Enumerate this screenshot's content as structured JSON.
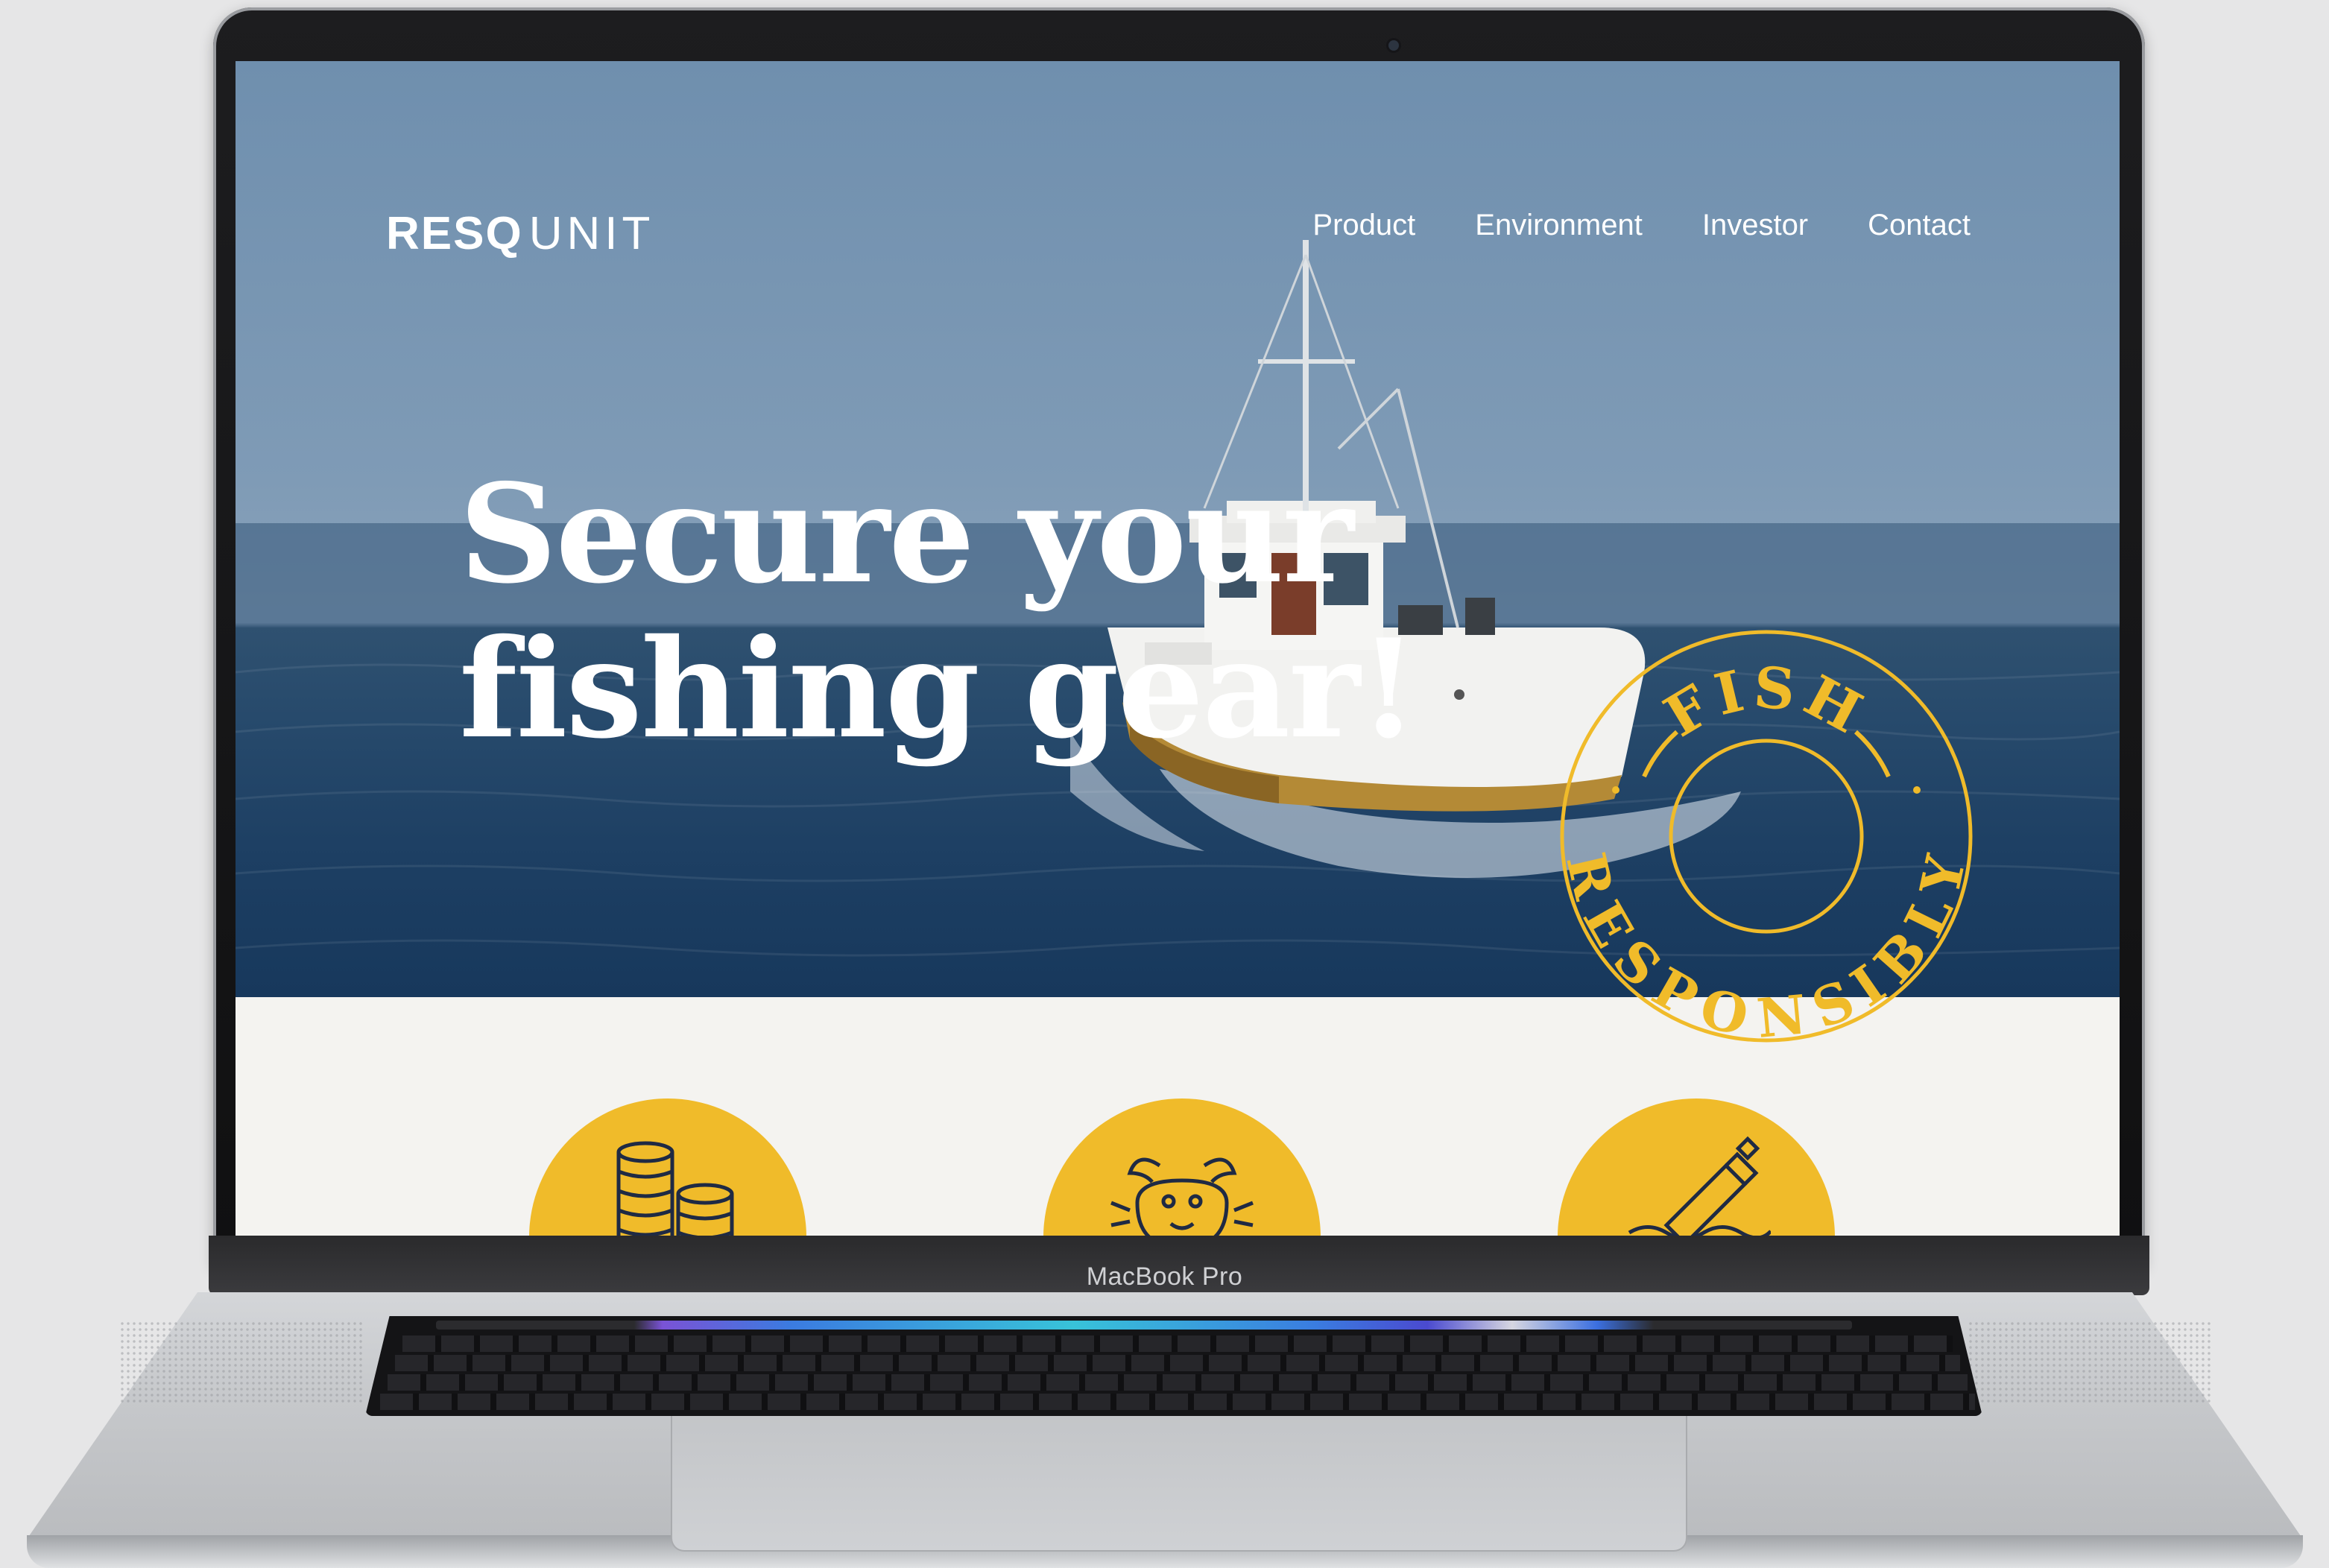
{
  "site": {
    "logo": {
      "bold": "RESQ",
      "light": "UNIT"
    },
    "nav": [
      "Product",
      "Environment",
      "Investor",
      "Contact"
    ],
    "hero": {
      "headline_line1": "Secure your",
      "headline_line2": "fishing gear!"
    },
    "badge": {
      "top_text": "FISH",
      "bottom_text": "RESPONSIBLY",
      "color": "#f0bb2a"
    },
    "features": [
      {
        "icon": "coins-stack-icon"
      },
      {
        "icon": "crab-icon"
      },
      {
        "icon": "buoy-marker-icon"
      }
    ],
    "accent_color": "#f0bb2a"
  },
  "device": {
    "label": "MacBook Pro"
  }
}
